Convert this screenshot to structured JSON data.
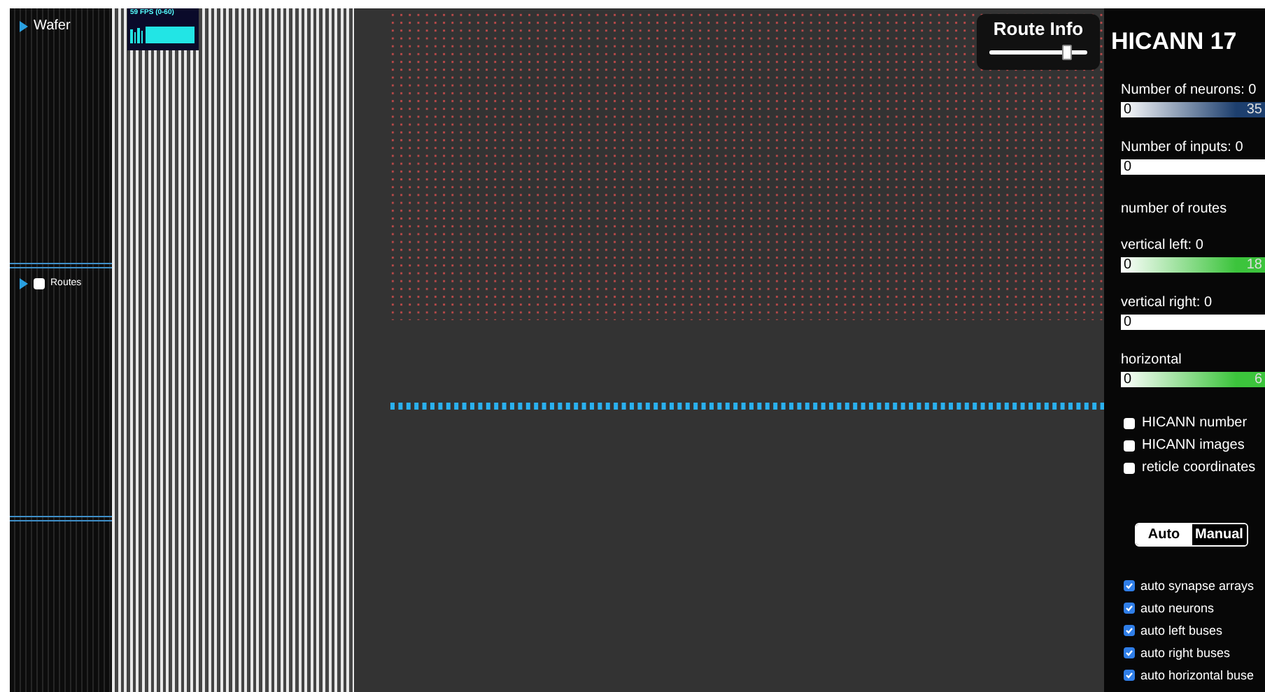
{
  "sidebar": {
    "items": [
      {
        "label": "Wafer",
        "kind": "folder"
      },
      {
        "label": "Routes",
        "kind": "toggle",
        "checked": false
      }
    ]
  },
  "fps_meter": {
    "label": "59 FPS (0-60)"
  },
  "route_info": {
    "title": "Route Info",
    "level": 0.78
  },
  "panel": {
    "title": "HICANN 17",
    "legends": [
      {
        "label": "Number of neurons: 0",
        "kind": "gradient",
        "min": "0",
        "max": "35",
        "color": "#1d3f6e"
      },
      {
        "label": "Number of inputs: 0",
        "kind": "plain",
        "min": "0"
      },
      {
        "label": "number of routes",
        "kind": "heading"
      },
      {
        "label": "vertical left: 0",
        "kind": "gradient",
        "min": "0",
        "max": "18",
        "color": "#3cc43c"
      },
      {
        "label": "vertical right: 0",
        "kind": "plain",
        "min": "0"
      },
      {
        "label": "horizontal",
        "kind": "gradient",
        "min": "0",
        "max": "6",
        "color": "#3cc43c"
      }
    ],
    "options": [
      {
        "label": "HICANN number",
        "checked": false
      },
      {
        "label": "HICANN images",
        "checked": false
      },
      {
        "label": "reticle coordinates",
        "checked": false
      }
    ],
    "modes": [
      {
        "label": "Auto",
        "selected": true
      },
      {
        "label": "Manual",
        "selected": false
      }
    ],
    "auto_options": [
      {
        "label": "auto synapse arrays",
        "checked": true
      },
      {
        "label": "auto neurons",
        "checked": true
      },
      {
        "label": "auto left buses",
        "checked": true
      },
      {
        "label": "auto right buses",
        "checked": true
      },
      {
        "label": "auto horizontal buse",
        "checked": true
      }
    ]
  }
}
